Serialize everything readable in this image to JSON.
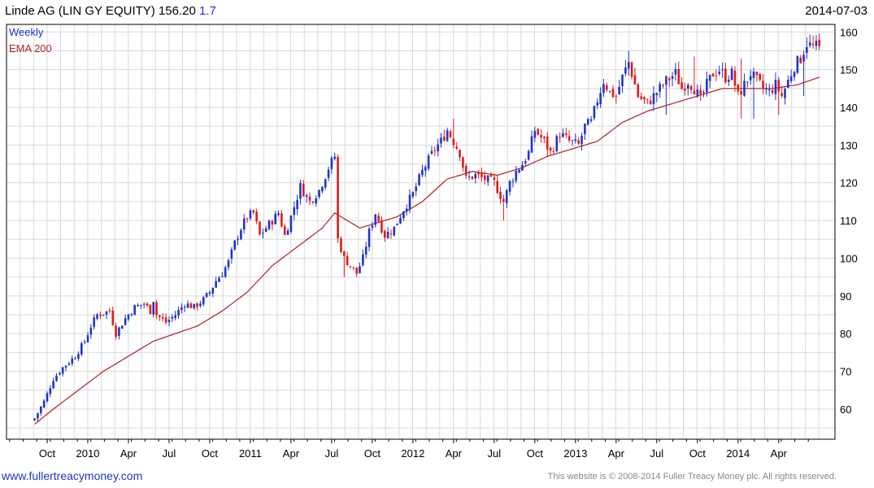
{
  "header": {
    "title": "Linde AG (LIN GY EQUITY) 156.20",
    "change": "1.7",
    "date": "2014-07-03"
  },
  "legend": {
    "weekly": "Weekly",
    "ema": "EMA 200"
  },
  "footer": {
    "url": "www.fullertreacymoney.com",
    "copyright": "This website is © 2008-2014 Fuller Treacy Money plc. All rights reserved."
  },
  "colors": {
    "up": "#1f35c9",
    "down": "#e01b1b",
    "ema": "#b02020",
    "grid": "#d9d9d9"
  },
  "chart_data": {
    "type": "candlestick",
    "interval": "weekly",
    "series_names": [
      "Weekly",
      "EMA 200"
    ],
    "ylim": [
      52,
      162
    ],
    "y_ticks": [
      60,
      70,
      80,
      90,
      100,
      110,
      120,
      130,
      140,
      150,
      160
    ],
    "x_tick_labels": [
      "Oct",
      "2010",
      "Apr",
      "Jul",
      "Oct",
      "2011",
      "Apr",
      "Jul",
      "Oct",
      "2012",
      "Apr",
      "Jul",
      "Oct",
      "2013",
      "Apr",
      "Jul",
      "Oct",
      "2014",
      "Apr"
    ],
    "x_tick_weeks": [
      4,
      17,
      30,
      43,
      56,
      69,
      82,
      95,
      108,
      121,
      134,
      147,
      160,
      173,
      186,
      199,
      212,
      225,
      238
    ],
    "x_range_weeks": [
      -9,
      256
    ],
    "close_anchors": [
      [
        0,
        57.5
      ],
      [
        3,
        62
      ],
      [
        6,
        68
      ],
      [
        9,
        71
      ],
      [
        13,
        74
      ],
      [
        16,
        78
      ],
      [
        18,
        82
      ],
      [
        20,
        85
      ],
      [
        24,
        86
      ],
      [
        26,
        80
      ],
      [
        29,
        84
      ],
      [
        32,
        87
      ],
      [
        35,
        88
      ],
      [
        37,
        86
      ],
      [
        38,
        89
      ],
      [
        39,
        85
      ],
      [
        42,
        83
      ],
      [
        45,
        85
      ],
      [
        48,
        88
      ],
      [
        51,
        87
      ],
      [
        54,
        89
      ],
      [
        56,
        91
      ],
      [
        58,
        94
      ],
      [
        60,
        96
      ],
      [
        62,
        99
      ],
      [
        64,
        104
      ],
      [
        66,
        108
      ],
      [
        68,
        111
      ],
      [
        70,
        112
      ],
      [
        72,
        106
      ],
      [
        75,
        109
      ],
      [
        78,
        112
      ],
      [
        80,
        106
      ],
      [
        82,
        111
      ],
      [
        85,
        119
      ],
      [
        88,
        115
      ],
      [
        91,
        118
      ],
      [
        94,
        124
      ],
      [
        96,
        127
      ],
      [
        97,
        105
      ],
      [
        99,
        100
      ],
      [
        101,
        98
      ],
      [
        103,
        96
      ],
      [
        105,
        100
      ],
      [
        107,
        107
      ],
      [
        109,
        112
      ],
      [
        112,
        106
      ],
      [
        115,
        108
      ],
      [
        118,
        113
      ],
      [
        121,
        117
      ],
      [
        124,
        123
      ],
      [
        128,
        129
      ],
      [
        130,
        131
      ],
      [
        132,
        134
      ],
      [
        134,
        131
      ],
      [
        136,
        128
      ],
      [
        138,
        121
      ],
      [
        141,
        122
      ],
      [
        144,
        121
      ],
      [
        147,
        120
      ],
      [
        150,
        115
      ],
      [
        152,
        120
      ],
      [
        154,
        123
      ],
      [
        156,
        125
      ],
      [
        158,
        128
      ],
      [
        160,
        134
      ],
      [
        163,
        131
      ],
      [
        165,
        128
      ],
      [
        168,
        133
      ],
      [
        171,
        131
      ],
      [
        174,
        130
      ],
      [
        176,
        135
      ],
      [
        178,
        136
      ],
      [
        180,
        142
      ],
      [
        182,
        147
      ],
      [
        184,
        144
      ],
      [
        186,
        143
      ],
      [
        188,
        148
      ],
      [
        190,
        152
      ],
      [
        193,
        143
      ],
      [
        196,
        141
      ],
      [
        199,
        144
      ],
      [
        202,
        147
      ],
      [
        205,
        149
      ],
      [
        207,
        145
      ],
      [
        209,
        147
      ],
      [
        211,
        145
      ],
      [
        213,
        142
      ],
      [
        215,
        146
      ],
      [
        217,
        149
      ],
      [
        219,
        150
      ],
      [
        221,
        148
      ],
      [
        223,
        149
      ],
      [
        225,
        143
      ],
      [
        227,
        146
      ],
      [
        229,
        149
      ],
      [
        231,
        147
      ],
      [
        233,
        145
      ],
      [
        235,
        144
      ],
      [
        237,
        146
      ],
      [
        239,
        143
      ],
      [
        241,
        147
      ],
      [
        243,
        151
      ],
      [
        245,
        153
      ],
      [
        247,
        157
      ],
      [
        249,
        156
      ],
      [
        251,
        156.2
      ]
    ],
    "lows": [
      [
        99,
        95
      ],
      [
        103,
        95
      ],
      [
        150,
        110
      ],
      [
        226,
        137
      ],
      [
        230,
        137
      ],
      [
        238,
        138
      ],
      [
        202,
        138
      ],
      [
        246,
        143
      ]
    ],
    "highs": [
      [
        96,
        128
      ],
      [
        134,
        137
      ],
      [
        190,
        155
      ],
      [
        226,
        153
      ],
      [
        247,
        158.5
      ],
      [
        211,
        153.5
      ]
    ],
    "ema_anchors": [
      [
        0,
        56
      ],
      [
        6,
        60
      ],
      [
        14,
        65
      ],
      [
        22,
        70
      ],
      [
        30,
        74
      ],
      [
        38,
        78
      ],
      [
        45,
        80
      ],
      [
        52,
        82
      ],
      [
        60,
        86
      ],
      [
        68,
        91
      ],
      [
        76,
        98
      ],
      [
        84,
        103
      ],
      [
        92,
        108
      ],
      [
        96,
        112
      ],
      [
        100,
        110
      ],
      [
        104,
        108
      ],
      [
        108,
        109
      ],
      [
        116,
        111
      ],
      [
        124,
        115
      ],
      [
        132,
        121
      ],
      [
        140,
        123
      ],
      [
        148,
        122
      ],
      [
        156,
        124
      ],
      [
        164,
        127
      ],
      [
        172,
        129
      ],
      [
        180,
        131
      ],
      [
        188,
        136
      ],
      [
        196,
        139
      ],
      [
        204,
        141
      ],
      [
        212,
        143
      ],
      [
        220,
        145
      ],
      [
        228,
        145
      ],
      [
        236,
        145
      ],
      [
        244,
        146
      ],
      [
        251,
        148
      ]
    ]
  }
}
